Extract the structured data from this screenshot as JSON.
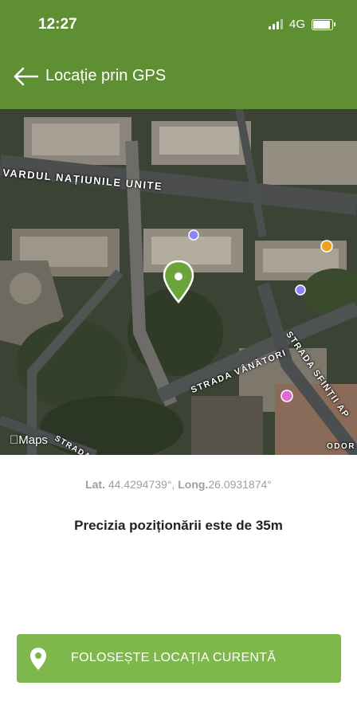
{
  "status_bar": {
    "time": "12:27",
    "network": "4G",
    "battery_level": 0.85
  },
  "header": {
    "title": "Locație prin GPS",
    "back_icon": "arrow-left-icon"
  },
  "map": {
    "provider": "Maps",
    "street_labels": {
      "bulevard": "VARDUL NAȚIUNILE UNITE",
      "vanatori": "STRADA VÂNĂTORI",
      "spintilor": "STRADA SFINȚII AP",
      "bottom": "STRADA",
      "odor": "ODOR"
    },
    "pin_color": "#6aa43a"
  },
  "location": {
    "lat_label": "Lat.",
    "lat_value": "44.4294739°",
    "long_label": "Long.",
    "long_value": "26.0931874°",
    "precision_text": "Precizia poziționării este de 35m"
  },
  "cta": {
    "label": "FOLOSEȘTE LOCAȚIA CURENTĂ",
    "icon": "location-pin-icon"
  },
  "colors": {
    "header": "#5f8f33",
    "button": "#7eb74c"
  }
}
